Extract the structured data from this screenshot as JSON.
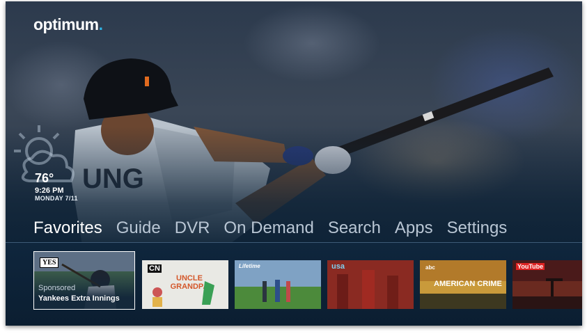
{
  "app": {
    "logo_text": "optimum",
    "logo_dot": "."
  },
  "weather": {
    "icon": "partly-cloudy-icon",
    "temperature": "76°",
    "time": "9:26 PM",
    "date": "MONDAY 7/11"
  },
  "nav": {
    "items": [
      {
        "label": "Favorites",
        "active": true
      },
      {
        "label": "Guide"
      },
      {
        "label": "DVR"
      },
      {
        "label": "On Demand"
      },
      {
        "label": "Search"
      },
      {
        "label": "Apps"
      },
      {
        "label": "Settings"
      }
    ]
  },
  "featured": {
    "channel_logo": "YES",
    "sponsored_label": "Sponsored",
    "title": "Yankees Extra Innings"
  },
  "tiles": [
    {
      "logo": "CN",
      "show_title": "UNCLE GRANDPA"
    },
    {
      "logo": "Lifetime"
    },
    {
      "logo": "usa"
    },
    {
      "logo": "abc",
      "show_title": "AMERICAN CRIME"
    },
    {
      "logo": "YouTube"
    }
  ],
  "colors": {
    "accent": "#2eb4e6",
    "nav_inactive": "#b9c6d4",
    "background": "#0d2236"
  }
}
